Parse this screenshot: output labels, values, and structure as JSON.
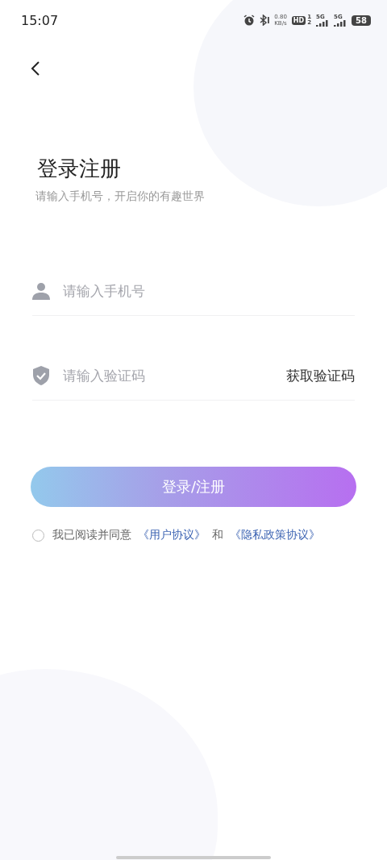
{
  "status_bar": {
    "time": "15:07",
    "speed_value": "0.80",
    "speed_unit": "KB/s",
    "hd_label": "HD",
    "sim_numbers": [
      "1",
      "2"
    ],
    "network_labels": [
      "5G",
      "5G"
    ],
    "battery": "58"
  },
  "title": "登录注册",
  "subtitle": "请输入手机号，开启你的有趣世界",
  "phone_field": {
    "placeholder": "请输入手机号"
  },
  "code_field": {
    "placeholder": "请输入验证码"
  },
  "get_code": "获取验证码",
  "submit_button": "登录/注册",
  "agreement": {
    "checked": false,
    "text": "我已阅读并同意",
    "user_link": "《用户协议》",
    "joiner": "和",
    "privacy_link": "《隐私政策协议》"
  }
}
